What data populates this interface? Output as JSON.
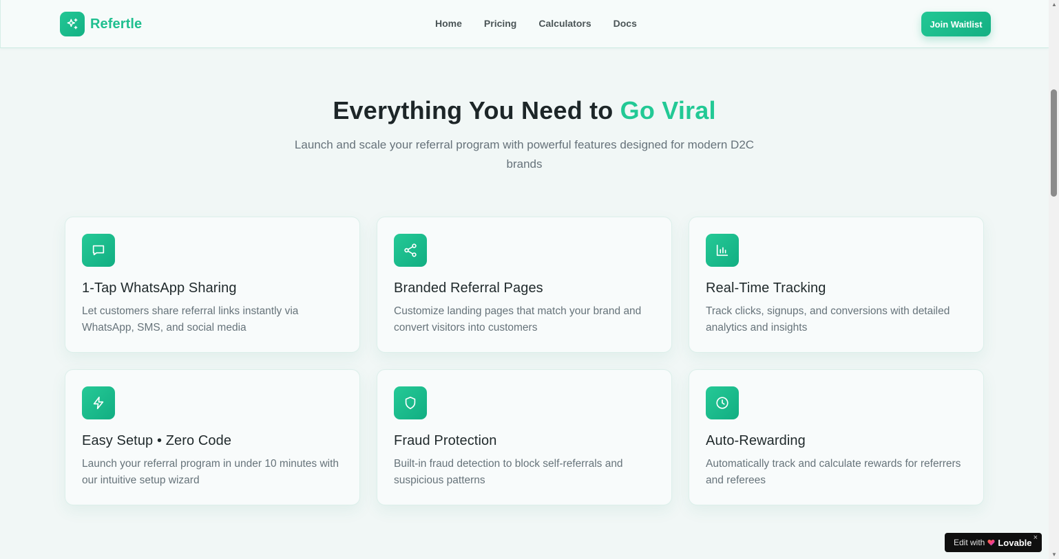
{
  "header": {
    "brand": "Refertle",
    "nav": [
      {
        "label": "Home"
      },
      {
        "label": "Pricing"
      },
      {
        "label": "Calculators"
      },
      {
        "label": "Docs"
      }
    ],
    "cta_label": "Join Waitlist"
  },
  "hero": {
    "title_main": "Everything You Need to",
    "title_accent": "Go Viral",
    "subtitle": "Launch and scale your referral program with powerful features designed for modern D2C brands"
  },
  "features": [
    {
      "icon": "message-square-icon",
      "title": "1-Tap WhatsApp Sharing",
      "description": "Let customers share referral links instantly via WhatsApp, SMS, and social media"
    },
    {
      "icon": "share-icon",
      "title": "Branded Referral Pages",
      "description": "Customize landing pages that match your brand and convert visitors into customers"
    },
    {
      "icon": "bar-chart-icon",
      "title": "Real-Time Tracking",
      "description": "Track clicks, signups, and conversions with detailed analytics and insights"
    },
    {
      "icon": "lightning-icon",
      "title": "Easy Setup • Zero Code",
      "description": "Launch your referral program in under 10 minutes with our intuitive setup wizard"
    },
    {
      "icon": "shield-icon",
      "title": "Fraud Protection",
      "description": "Built-in fraud detection to block self-referrals and suspicious patterns"
    },
    {
      "icon": "clock-icon",
      "title": "Auto-Rewarding",
      "description": "Automatically track and calculate rewards for referrers and referees"
    }
  ],
  "badge": {
    "prefix": "Edit with",
    "brand": "Lovable",
    "close": "×"
  },
  "colors": {
    "accent": "#22c995",
    "background": "#f1f7f6",
    "heading": "#1d2628",
    "muted_text": "#66727a"
  }
}
